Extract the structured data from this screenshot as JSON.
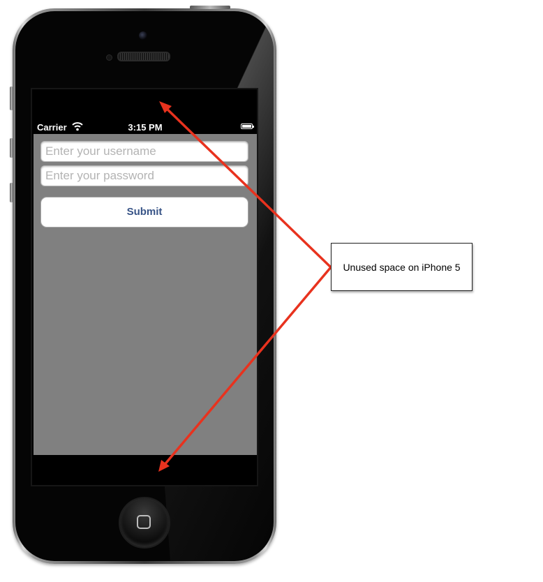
{
  "status_bar": {
    "carrier": "Carrier",
    "time": "3:15 PM",
    "wifi_icon": "wifi-icon",
    "battery_icon": "battery-icon"
  },
  "form": {
    "username_placeholder": "Enter your username",
    "password_placeholder": "Enter your password",
    "submit_label": "Submit"
  },
  "annotation": {
    "callout_text": "Unused space on iPhone 5",
    "arrow_color": "#e8321e"
  },
  "colors": {
    "app_background": "#808080",
    "button_text": "#385487"
  }
}
